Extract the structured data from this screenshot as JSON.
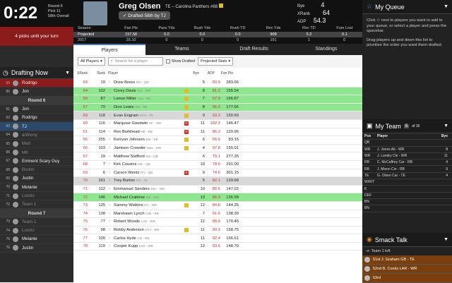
{
  "timer": {
    "clock": "0:22",
    "round": "Round 6",
    "pick": "Pick 11",
    "overall": "58th Overall",
    "turn": "4 picks until your turn"
  },
  "drafting": {
    "title": "Drafting Now",
    "rows": [
      {
        "n": "59",
        "name": "Rodrigo",
        "cls": "red"
      },
      {
        "n": "60",
        "name": "Jon",
        "cls": ""
      },
      {
        "round": "Round 6"
      },
      {
        "n": "61",
        "name": "Jon",
        "cls": ""
      },
      {
        "n": "62",
        "name": "Rodrigo",
        "cls": ""
      },
      {
        "n": "63",
        "name": "TJ",
        "cls": "hl"
      },
      {
        "n": "64",
        "name": "anthony",
        "cls": "dim"
      },
      {
        "n": "65",
        "name": "Matt",
        "cls": "dim"
      },
      {
        "n": "66",
        "name": "MK",
        "cls": "dim"
      },
      {
        "n": "67",
        "name": "Eminent Scary Guy",
        "cls": ""
      },
      {
        "n": "68",
        "name": "Bunim",
        "cls": "dim"
      },
      {
        "n": "69",
        "name": "Justin",
        "cls": ""
      },
      {
        "n": "70",
        "name": "Melanie",
        "cls": ""
      },
      {
        "n": "71",
        "name": "Loreto",
        "cls": "dim"
      },
      {
        "n": "72",
        "name": "Team 1",
        "cls": "dim"
      },
      {
        "round": "Round 7"
      },
      {
        "n": "73",
        "name": "Team 1",
        "cls": "dim"
      },
      {
        "n": "74",
        "name": "Loreto",
        "cls": "dim"
      },
      {
        "n": "75",
        "name": "Melanie",
        "cls": ""
      },
      {
        "n": "76",
        "name": "Justin",
        "cls": ""
      }
    ]
  },
  "player": {
    "name": "Greg Olsen",
    "team": "TE – Carolina Panthers #88",
    "drafted": "Drafted 58th by TJ",
    "bye_label": "Bye",
    "bye": "4",
    "xrank_label": "XRank",
    "xrank": "64",
    "adp_label": "ADP",
    "adp": "54.3",
    "grid_head": [
      "Season",
      "Fan Pts",
      "Pass Yds",
      "Rush Yds",
      "Rush TD",
      "Rec Yds",
      "Rec TD",
      "Fum Lost"
    ],
    "grid_rows": [
      [
        "Projected",
        "157.58",
        "0.0",
        "0.0",
        "0.0",
        "908",
        "5.2",
        "0.1"
      ],
      [
        "2017",
        "25.10",
        "0",
        "0",
        "0",
        "191",
        "1",
        "0"
      ]
    ]
  },
  "tabs": [
    "Players",
    "Teams",
    "Draft Results",
    "Standings"
  ],
  "filters": {
    "position": "All Players",
    "search_placeholder": "Search for a player",
    "show_drafted": "Show Drafted",
    "stats": "Projected Stats"
  },
  "table_head": {
    "xrank": "XRank",
    "rank": "Rank",
    "player": "Player",
    "bye": "Bye",
    "adp": "ADP",
    "pts": "Fan Pts"
  },
  "players": [
    {
      "x": "53",
      "r": "10",
      "n": "Drew Brees",
      "m": "NO - QB",
      "f": "",
      "b": "5",
      "a": "50.9",
      "p": "283.66",
      "c": ""
    },
    {
      "x": "54",
      "r": "102",
      "n": "Corey Davis",
      "m": "Ten - WR",
      "f": "y",
      "b": "8",
      "a": "81.2",
      "p": "155.54",
      "c": "g"
    },
    {
      "x": "56",
      "r": "87",
      "n": "Lamar Miller",
      "m": "Hou - RB",
      "f": "y",
      "b": "7",
      "a": "67.9",
      "p": "166.87",
      "c": "g"
    },
    {
      "x": "57",
      "r": "70",
      "n": "Dion Lewis",
      "m": "Ten - RB",
      "f": "y",
      "b": "8",
      "a": "66.5",
      "p": "177.66",
      "c": "g"
    },
    {
      "x": "69",
      "r": "118",
      "n": "Evan Engram",
      "m": "NYG - TE",
      "f": "y",
      "b": "9",
      "a": "53.2",
      "p": "150.50",
      "c": "gr"
    },
    {
      "x": "60",
      "r": "116",
      "n": "Marquise Goodwin",
      "m": "SF - WR",
      "f": "r",
      "b": "11",
      "a": "102.2",
      "p": "146.47",
      "c": ""
    },
    {
      "x": "61",
      "r": "114",
      "n": "Rex Burkhead",
      "m": "NE - RB",
      "f": "r",
      "b": "11",
      "a": "86.2",
      "p": "120.96",
      "c": ""
    },
    {
      "x": "65",
      "r": "255",
      "n": "Kerryon Johnson",
      "m": "Det - RB",
      "f": "y",
      "b": "6",
      "a": "56.6",
      "p": "83.15",
      "c": ""
    },
    {
      "x": "66",
      "r": "103",
      "n": "Jamison Crowder",
      "m": "Was - WR",
      "f": "y",
      "b": "4",
      "a": "97.8",
      "p": "155.01",
      "c": ""
    },
    {
      "x": "67",
      "r": "19",
      "n": "Matthew Stafford",
      "m": "Det - QB",
      "f": "",
      "b": "6",
      "a": "79.1",
      "p": "277.35",
      "c": ""
    },
    {
      "x": "68",
      "r": "7",
      "n": "Kirk Cousins",
      "m": "Min - QB",
      "f": "",
      "b": "10",
      "a": "78.6",
      "p": "291.00",
      "c": ""
    },
    {
      "x": "69",
      "r": "6",
      "n": "Carson Wentz",
      "m": "Phi - QB",
      "f": "r",
      "b": "9",
      "a": "74.6",
      "p": "301.15",
      "c": ""
    },
    {
      "x": "70",
      "r": "161",
      "n": "Trey Burton",
      "m": "Chi - TE",
      "f": "",
      "b": "5",
      "a": "82.1",
      "p": "129.68",
      "c": "gr"
    },
    {
      "x": "71",
      "r": "112",
      "n": "Emmanuel Sanders",
      "m": "Den - WR",
      "f": "",
      "b": "10",
      "a": "80.6",
      "p": "147.02",
      "c": ""
    },
    {
      "x": "72",
      "r": "146",
      "n": "Michael Crabtree",
      "m": "Bal - WR",
      "f": "",
      "b": "10",
      "a": "86.9",
      "p": "136.58",
      "c": "g"
    },
    {
      "x": "73",
      "r": "125",
      "n": "Sammy Watkins",
      "m": "KC - WR",
      "f": "y",
      "b": "12",
      "a": "84.8",
      "p": "144.35",
      "c": ""
    },
    {
      "x": "74",
      "r": "138",
      "n": "Marshawn Lynch",
      "m": "Oak - RB",
      "f": "",
      "b": "7",
      "a": "91.6",
      "p": "138.30",
      "c": ""
    },
    {
      "x": "75",
      "r": "77",
      "n": "Robert Woods",
      "m": "LAR - WR",
      "f": "",
      "b": "12",
      "a": "88.0",
      "p": "170.45",
      "c": ""
    },
    {
      "x": "76",
      "r": "98",
      "n": "Robby Anderson",
      "m": "NYJ - WR",
      "f": "y",
      "b": "11",
      "a": "90.9",
      "p": "158.75",
      "c": ""
    },
    {
      "x": "77",
      "r": "100",
      "n": "Carlos Hyde",
      "m": "Cle - RB",
      "f": "",
      "b": "11",
      "a": "92.4",
      "p": "156.61",
      "c": ""
    },
    {
      "x": "78",
      "r": "110",
      "n": "Cooper Kupp",
      "m": "LAR - WR",
      "f": "",
      "b": "12",
      "a": "93.6",
      "p": "148.79",
      "c": ""
    }
  ],
  "queue": {
    "title": "My Queue",
    "p1": "Click ☆ next to players you want to add to your queue, or select a player and press the spacebar.",
    "p2": "Drag players up and down this list to prioritize the order you want them drafted."
  },
  "myteam": {
    "title": "My Team",
    "count": "5",
    "of": "of 15",
    "head": {
      "pos": "Pos",
      "player": "Player",
      "bye": "Bye"
    },
    "rows": [
      [
        "QB",
        "",
        ""
      ],
      [
        "WR",
        "J. Jones Atl - WR",
        "8"
      ],
      [
        "WR",
        "J. Landry Cle - WR",
        "11"
      ],
      [
        "RB",
        "C. McCaffrey Car - RB",
        "4"
      ],
      [
        "RB",
        "J. Mixon Cin - RB",
        "9"
      ],
      [
        "TE",
        "G. Olsen Car - TE",
        "4"
      ],
      [
        "W/R/T",
        "",
        ""
      ],
      [
        "K",
        "",
        ""
      ],
      [
        "DEF",
        "",
        ""
      ],
      [
        "BN",
        "",
        ""
      ],
      [
        "BN",
        "",
        ""
      ]
    ]
  },
  "smack": {
    "title": "Smack Talk",
    "left": "Team 1 left",
    "items": [
      "51st J. Graham GB - TE",
      "52nd B. Cooks LAR - WR",
      "53rd"
    ]
  }
}
